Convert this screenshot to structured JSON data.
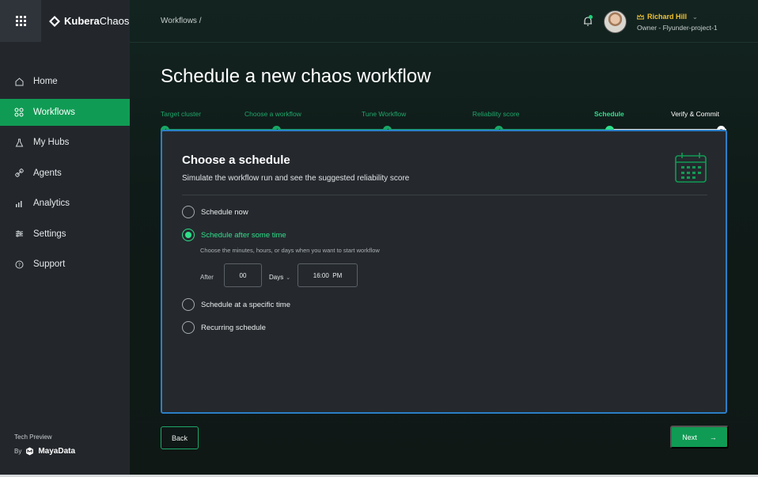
{
  "brand": {
    "name_bold": "Kubera",
    "name_light": "Chaos"
  },
  "sidebar": {
    "items": [
      {
        "label": "Home",
        "icon": "home-icon"
      },
      {
        "label": "Workflows",
        "icon": "workflows-icon",
        "active": true
      },
      {
        "label": "My Hubs",
        "icon": "flask-icon"
      },
      {
        "label": "Agents",
        "icon": "link-icon"
      },
      {
        "label": "Analytics",
        "icon": "analytics-icon"
      },
      {
        "label": "Settings",
        "icon": "settings-icon"
      },
      {
        "label": "Support",
        "icon": "help-icon"
      }
    ],
    "footer_label": "Tech Preview",
    "by_label": "By",
    "company": "MayaData"
  },
  "header": {
    "breadcrumb": "Workflows  /",
    "user_name": "Richard Hill",
    "user_role": "Owner - Flyunder-project-1"
  },
  "page_title": "Schedule a new chaos workflow",
  "steps": [
    {
      "label": "Target cluster",
      "state": "done"
    },
    {
      "label": "Choose a workflow",
      "state": "done"
    },
    {
      "label": "Tune Workflow",
      "state": "done"
    },
    {
      "label": "Reliability score",
      "state": "done"
    },
    {
      "label": "Schedule",
      "state": "current"
    },
    {
      "label": "Verify & Commit",
      "state": "pending"
    }
  ],
  "card": {
    "title": "Choose a schedule",
    "subtitle": "Simulate the workflow run and see the suggested reliability score",
    "options": [
      {
        "label": "Schedule now",
        "selected": false
      },
      {
        "label": "Schedule after some time",
        "selected": true
      },
      {
        "label": "Schedule at a specific time",
        "selected": false
      },
      {
        "label": "Recurring schedule",
        "selected": false
      }
    ],
    "hint": "Choose the minutes, hours, or days when you want to start workflow",
    "after_label": "After",
    "amount_value": "00",
    "unit_value": "Days",
    "time_value": "16:00  PM"
  },
  "buttons": {
    "back": "Back",
    "next": "Next"
  },
  "colors": {
    "accent": "#109b54",
    "highlight": "#2ee08a",
    "card_border": "#2b7fc7",
    "user_name": "#f1c232"
  }
}
